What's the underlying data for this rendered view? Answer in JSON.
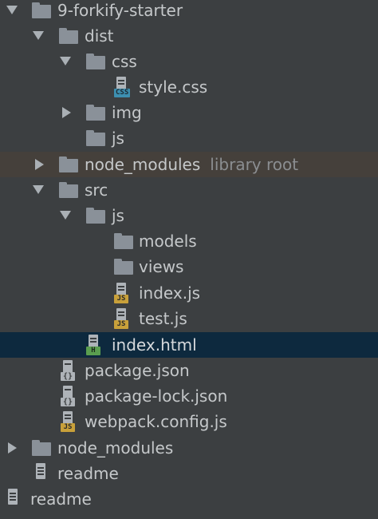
{
  "tree": {
    "project_root": "9-forkify-starter",
    "dist": "dist",
    "css": "css",
    "style_css": "style.css",
    "img": "img",
    "dist_js": "js",
    "node_modules_lib": "node_modules",
    "library_root": "library root",
    "src": "src",
    "src_js": "js",
    "models": "models",
    "views": "views",
    "index_js": "index.js",
    "test_js": "test.js",
    "index_html": "index.html",
    "package_json": "package.json",
    "package_lock": "package-lock.json",
    "webpack_config": "webpack.config.js",
    "node_modules": "node_modules",
    "readme_1": "readme",
    "readme_2": "readme"
  },
  "badges": {
    "css": "CSS",
    "js": "JS",
    "html": "H",
    "json": "{}"
  },
  "colors": {
    "background": "#3c3f41",
    "selection": "#0d293e",
    "library_row": "#45403b",
    "folder": "#8a9199",
    "css_badge": "#3d8fb0",
    "js_badge": "#c8a03a",
    "html_badge": "#5a9e4f"
  }
}
